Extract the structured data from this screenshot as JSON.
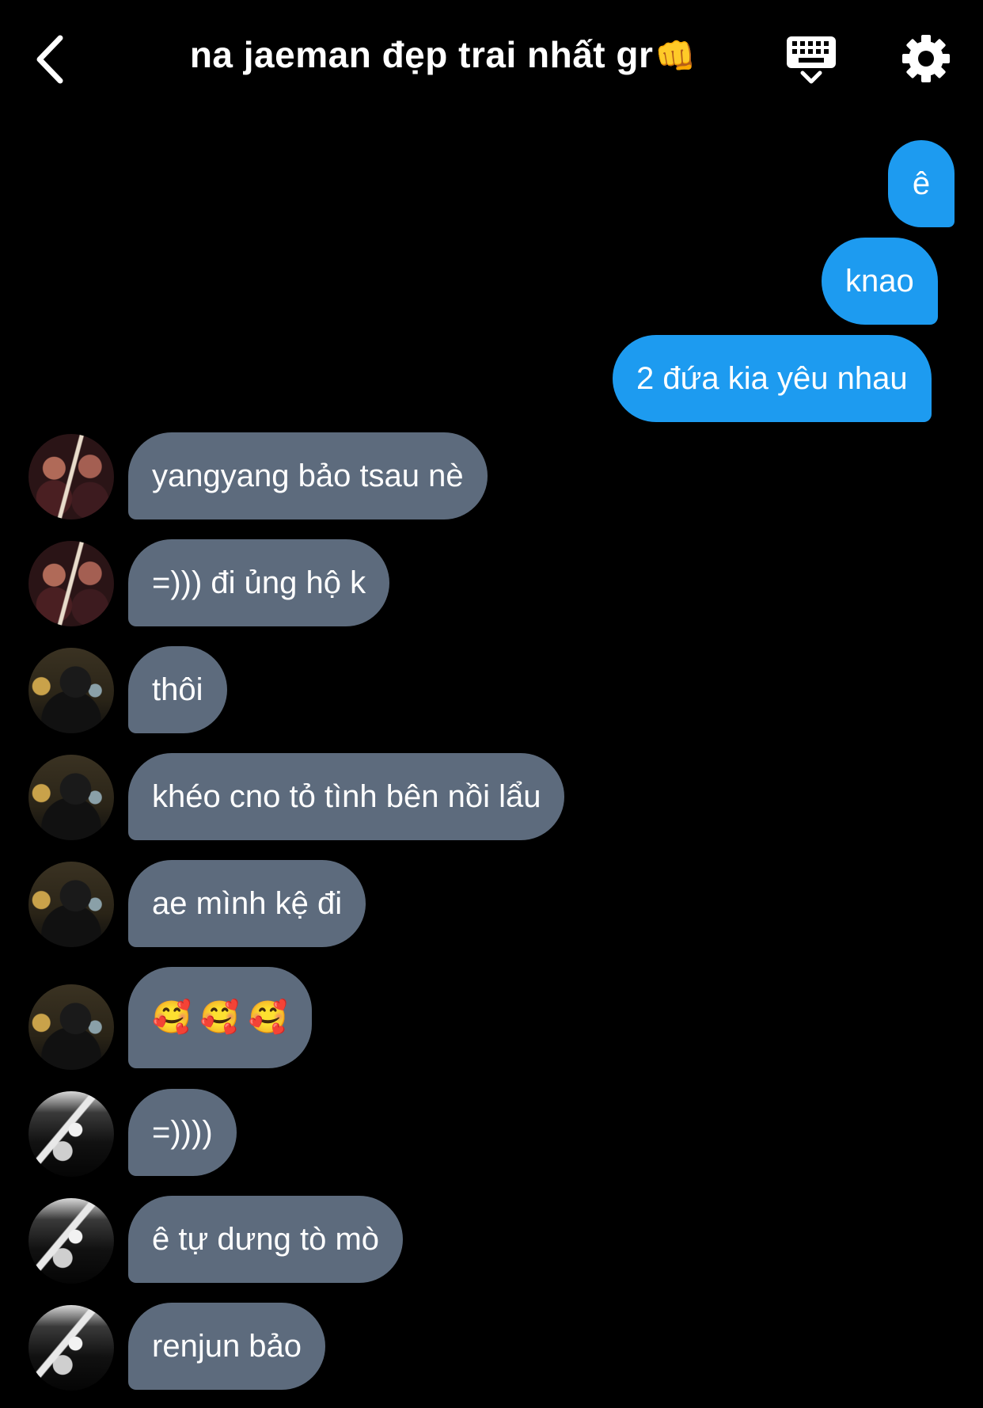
{
  "header": {
    "back_icon": "chevron-left-icon",
    "title": "na jaeman đẹp trai nhất gr",
    "title_emoji": "👊",
    "keyboard_icon": "keyboard-hide-icon",
    "settings_icon": "gear-icon"
  },
  "colors": {
    "background": "#000000",
    "outgoing_bubble": "#1d9bf0",
    "incoming_bubble": "#5d6b7d",
    "text": "#ffffff"
  },
  "messages": [
    {
      "direction": "out",
      "text": "ê"
    },
    {
      "direction": "out",
      "text": "knao"
    },
    {
      "direction": "out",
      "text": "2 đứa kia yêu nhau"
    },
    {
      "direction": "in",
      "avatar": "a1",
      "text": "yangyang bảo tsau nè"
    },
    {
      "direction": "in",
      "avatar": "a1",
      "text": "=))) đi ủng hộ k"
    },
    {
      "direction": "in",
      "avatar": "a2",
      "text": "thôi"
    },
    {
      "direction": "in",
      "avatar": "a2",
      "text": "khéo cno tỏ tình bên nồi lẩu"
    },
    {
      "direction": "in",
      "avatar": "a2",
      "text": "ae mình kệ đi"
    },
    {
      "direction": "in",
      "avatar": "a2",
      "text": "🥰 🥰 🥰"
    },
    {
      "direction": "in",
      "avatar": "a3",
      "text": "=))))"
    },
    {
      "direction": "in",
      "avatar": "a3",
      "text": "ê tự dưng tò mò"
    },
    {
      "direction": "in",
      "avatar": "a3",
      "text": "renjun bảo"
    }
  ]
}
